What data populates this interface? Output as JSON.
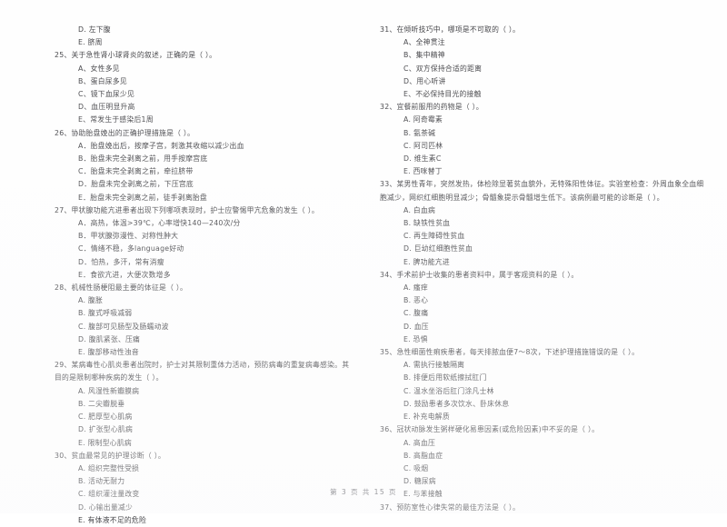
{
  "document": {
    "footer": "第 3 页 共 15 页",
    "page_number": "3",
    "total_pages": "15"
  },
  "left_column": {
    "orphan_options": [
      "D. 左下腹",
      "E. 脐周"
    ],
    "questions": [
      {
        "stem": "25、关于急性肾小球肾炎的叙述，正确的是（     ）。",
        "options": [
          "A、女性多见",
          "B、蛋白尿多见",
          "C、镜下血尿少见",
          "D、血压明显升高",
          "E、常发生于感染后1周"
        ]
      },
      {
        "stem": "26、协助胎盘娩出的正确护理措施是（     ）。",
        "options": [
          "A．胎盘娩出后，按摩子宫，刺激其收缩以减少出血",
          "B．胎盘未完全剥离之前，用手按摩宫底",
          "C．胎盘未完全剥离之前，牵拉脐带",
          "D．胎盘未完全剥离之前，下压宫底",
          "E．胎盘未完全剥离之前，徒手剥离胎盘"
        ]
      },
      {
        "stem": "27、甲状腺功能亢进患者出现下列哪项表现时，护士应警惕甲亢危象的发生（     ）。",
        "options": [
          "A．高热，体温>39℃，心率增快140—240次/分",
          "B．甲状腺弥漫性、对称性肿大",
          "C．情绪不稳，多language好动",
          "D．怕热，多汗，常有消瘦",
          "E．食欲亢进，大便次数增多"
        ]
      },
      {
        "stem": "28、机械性肠梗阻最主要的体征是（     ）。",
        "options": [
          "A. 腹胀",
          "B. 腹式呼吸减弱",
          "C. 腹部可见肠型及肠蠕动波",
          "D. 腹肌紧张、压痛",
          "E. 腹部移动性浊音"
        ]
      },
      {
        "stem": "29、某病毒性心肌炎患者出院时，护士对其限制重体力活动，预防病毒的重复病毒感染。其目的是限制哪种疾病的发生（     ）。",
        "options": [
          "A. 风湿性新瓣膜病",
          "B. 二尖瓣脱垂",
          "C. 肥厚型心肌病",
          "D. 扩张型心肌病",
          "E. 限制型心肌病"
        ]
      },
      {
        "stem": "30、贫血最常见的护理诊断（     ）。",
        "options": [
          "A. 组织完整性受损",
          "B. 活动无耐力",
          "C. 组织灌注量改变",
          "D. 心输出量减少",
          "E. 有体液不足的危险"
        ]
      }
    ]
  },
  "right_column": {
    "questions": [
      {
        "stem": "31、在倾听技巧中，哪项是不可取的（     ）。",
        "options": [
          "A、全神贯注",
          "B、集中精神",
          "C、双方保持合适的距离",
          "D、用心听讲",
          "E、不必保持目光的接触"
        ]
      },
      {
        "stem": "32、宜餐前服用的药物是（     ）。",
        "options": [
          "A. 阿奇霉素",
          "B. 氨茶碱",
          "C. 阿司匹林",
          "D. 维生素C",
          "E. 西咪替丁"
        ]
      },
      {
        "stem": "33、某男性青年，突然发热，体检除显著贫血貌外，无特殊阳性体征。实验室检查：外周血象全血细胞减少，网织红细胞明显减少；骨髓象提示骨髓增生低下。该病例最可能的诊断是（     ）。",
        "options": [
          "A. 白血病",
          "B. 缺铁性贫血",
          "C. 再生障碍性贫血",
          "D. 巨幼红细胞性贫血",
          "E. 脾功能亢进"
        ]
      },
      {
        "stem": "34、手术前护士收集的患者资料中，属于客观资料的是（     ）。",
        "options": [
          "A. 瘙痒",
          "B. 恶心",
          "C. 腹痛",
          "D. 血压",
          "E. 恐惧"
        ]
      },
      {
        "stem": "35、急性细菌性痢疾患者，每天排脓血便7～8次，下述护理措施错误的是（     ）。",
        "options": [
          "A. 需执行接触隔离",
          "B. 排便后用软纸擦拭肛门",
          "C. 温水坐浴后肛门涂凡士林",
          "D. 鼓励患者多次饮水、卧床休息",
          "E. 补充电解质"
        ]
      },
      {
        "stem": "36、冠状动脉发生粥样硬化易患因素(或危险因素)中不妥的是（     ）。",
        "options": [
          "A. 高血压",
          "B. 高脂血症",
          "C. 吸烟",
          "D. 糖尿病",
          "E. 与苯接触"
        ]
      },
      {
        "stem": "37、预防室性心律失常的最佳方法是（     ）。",
        "options": []
      }
    ]
  }
}
